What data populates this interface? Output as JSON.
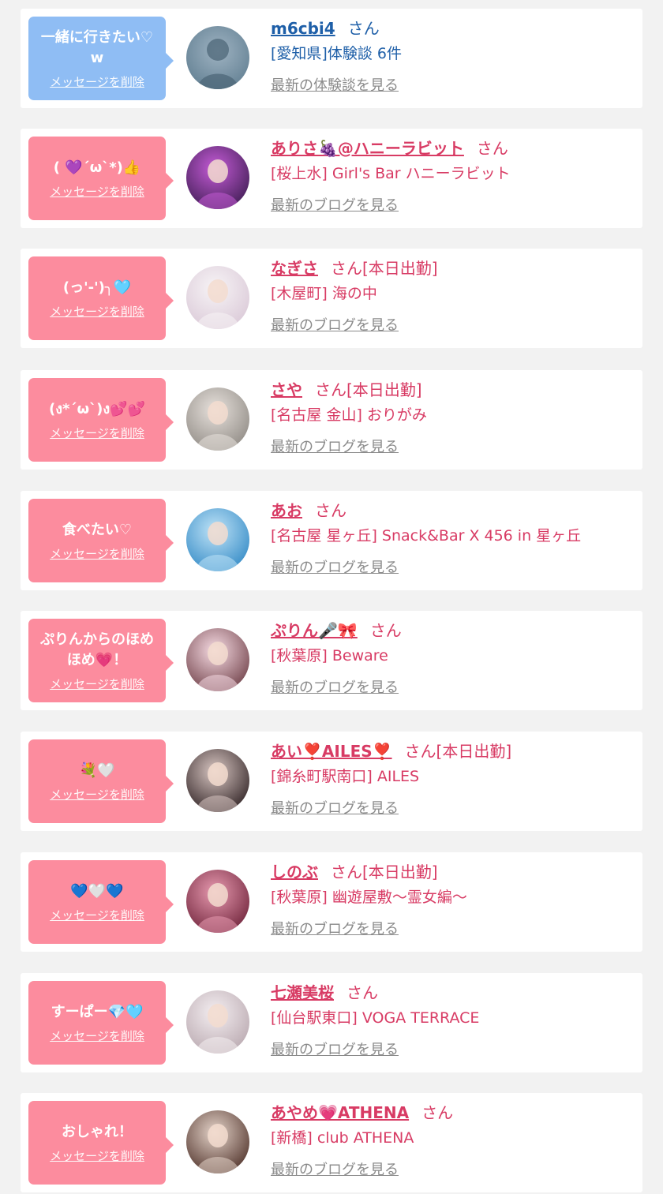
{
  "delete_label": "メッセージを削除",
  "items": [
    {
      "theme": "blue",
      "message": "一緒に行きたい♡w",
      "username": "m6cbi4",
      "honorific": "さん",
      "status": "",
      "location": "[愛知県]体験談 6件",
      "link": "最新の体験談を見る",
      "avatar_icon": "no-photo-icon",
      "avatar_colors": [
        "#9fb3c2",
        "#5f7d90"
      ]
    },
    {
      "theme": "pink",
      "message": "( 💜´ω`*)👍",
      "username": "ありさ🍇@ハニーラビット",
      "honorific": "さん",
      "status": "",
      "location": "[桜上水] Girl's Bar ハニーラビット",
      "link": "最新のブログを見る",
      "avatar_icon": "profile-photo",
      "avatar_colors": [
        "#c45bd6",
        "#3b1b4f"
      ]
    },
    {
      "theme": "pink",
      "message": "(っ'-')╮🩵",
      "username": "なぎさ",
      "honorific": "さん",
      "status": "[本日出勤]",
      "location": "[木屋町] 海の中",
      "link": "最新のブログを見る",
      "avatar_icon": "profile-photo",
      "avatar_colors": [
        "#f7f4f6",
        "#d9c7d6"
      ]
    },
    {
      "theme": "pink",
      "message": "(ง*´ω`)ง💕💕",
      "username": "さや",
      "honorific": "さん",
      "status": "[本日出勤]",
      "location": "[名古屋 金山] おりがみ",
      "link": "最新のブログを見る",
      "avatar_icon": "profile-photo",
      "avatar_colors": [
        "#e7e1dc",
        "#8c8781"
      ]
    },
    {
      "theme": "pink",
      "message": "食べたい♡",
      "username": "あお",
      "honorific": "さん",
      "status": "",
      "location": "[名古屋 星ヶ丘] Snack&Bar X 456 in 星ヶ丘",
      "link": "最新のブログを見る",
      "avatar_icon": "profile-photo",
      "avatar_colors": [
        "#bfe3f7",
        "#2e87c4"
      ]
    },
    {
      "theme": "pink",
      "message": "ぷりんからのほめほめ💗！",
      "username": "ぷりん🎤🎀",
      "honorific": "さん",
      "status": "",
      "location": "[秋葉原] Beware",
      "link": "最新のブログを見る",
      "avatar_icon": "profile-photo",
      "avatar_colors": [
        "#f6dbe3",
        "#6b3b43"
      ]
    },
    {
      "theme": "pink",
      "message": "💐🤍",
      "username": "あい❣️AILES❣️",
      "honorific": "さん",
      "status": "[本日出勤]",
      "location": "[錦糸町駅南口] AILES",
      "link": "最新のブログを見る",
      "avatar_icon": "profile-photo",
      "avatar_colors": [
        "#d8c6c2",
        "#2a1d1f"
      ]
    },
    {
      "theme": "pink",
      "message": "💙🤍💙",
      "username": "しのぶ",
      "honorific": "さん",
      "status": "[本日出勤]",
      "location": "[秋葉原] 幽遊屋敷〜霊女編〜",
      "link": "最新のブログを見る",
      "avatar_icon": "profile-photo",
      "avatar_colors": [
        "#e79ab0",
        "#6b1f36"
      ]
    },
    {
      "theme": "pink",
      "message": "すーぱー💎🩵",
      "username": "七瀬美桜",
      "honorific": "さん",
      "status": "",
      "location": "[仙台駅東口] VOGA TERRACE",
      "link": "最新のブログを見る",
      "avatar_icon": "profile-photo",
      "avatar_colors": [
        "#f4eef1",
        "#b7a6ad"
      ]
    },
    {
      "theme": "pink",
      "message": "おしゃれ！",
      "username": "あやめ💗ATHENA",
      "honorific": "さん",
      "status": "",
      "location": "[新橋] club ATHENA",
      "link": "最新のブログを見る",
      "avatar_icon": "profile-photo",
      "avatar_colors": [
        "#e4d3c9",
        "#4a2c24"
      ]
    }
  ]
}
